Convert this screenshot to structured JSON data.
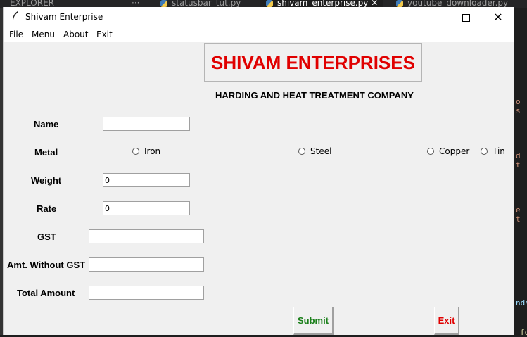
{
  "editor": {
    "tabs": [
      {
        "label": "EXPLORER"
      },
      {
        "label": "···"
      },
      {
        "label": "statusbar_tut.py"
      },
      {
        "label": "shivam_enterprise.py"
      },
      {
        "label": "youtube_downloader.py"
      }
    ],
    "close_glyph": "✕",
    "code_fragments": [
      "o s",
      "d t",
      "e t",
      "nds",
      "fo"
    ]
  },
  "window": {
    "title": "Shivam Enterprise",
    "controls": {
      "minimize": "—",
      "maximize": "☐",
      "close": "✕"
    }
  },
  "menu": [
    "File",
    "Menu",
    "About",
    "Exit"
  ],
  "heading": "SHIVAM ENTERPRISES",
  "subheading": "HARDING AND HEAT TREATMENT COMPANY",
  "form": {
    "name_label": "Name",
    "name_value": "",
    "metal_label": "Metal",
    "metals": [
      "Iron",
      "Steel",
      "Copper",
      "Tin"
    ],
    "weight_label": "Weight",
    "weight_value": "0",
    "rate_label": "Rate",
    "rate_value": "0",
    "gst_label": "GST",
    "gst_value": "",
    "amt_without_gst_label": "Amt. Without GST",
    "amt_without_gst_value": "",
    "total_label": "Total Amount",
    "total_value": ""
  },
  "buttons": {
    "submit": "Submit",
    "exit": "Exit",
    "submit_color": "#1a7f1a",
    "exit_color": "#e00000"
  },
  "colors": {
    "heading": "#e00000",
    "window_bg": "#f0f0f0"
  }
}
